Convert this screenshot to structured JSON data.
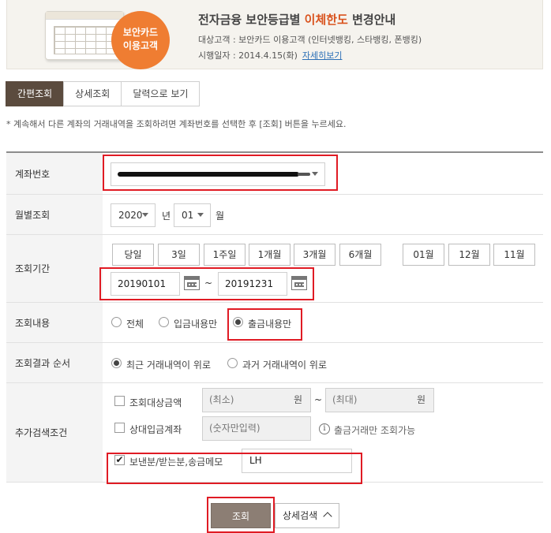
{
  "banner": {
    "card_badge_line1": "보안카드",
    "card_badge_line2": "이용고객",
    "title_prefix": "전자금융 보안등급별 ",
    "title_highlight": "이체한도",
    "title_suffix": " 변경안내",
    "target_line": "대상고객 : 보안카드 이용고객 (인터넷뱅킹, 스타뱅킹, 폰뱅킹)",
    "date_line": "시행일자 : 2014.4.15(화)",
    "detail_link": "자세히보기"
  },
  "tabs": [
    {
      "label": "간편조회",
      "active": true
    },
    {
      "label": "상세조회",
      "active": false
    },
    {
      "label": "달력으로 보기",
      "active": false
    }
  ],
  "note": "* 계속해서 다른 계좌의 거래내역을 조회하려면 계좌번호를 선택한 후 [조회] 버튼을 누르세요.",
  "form": {
    "account": {
      "label": "계좌번호"
    },
    "month": {
      "label": "월별조회",
      "year": "2020",
      "year_unit": "년",
      "month": "01",
      "month_unit": "월"
    },
    "period": {
      "label": "조회기간",
      "quick_buttons": [
        "당일",
        "3일",
        "1주일",
        "1개월",
        "3개월",
        "6개월"
      ],
      "month_buttons": [
        "01월",
        "12월",
        "11월"
      ],
      "start_date": "20190101",
      "separator": "~",
      "end_date": "20191231"
    },
    "content": {
      "label": "조회내용",
      "options": [
        "전체",
        "입금내용만",
        "출금내용만"
      ],
      "selected": "출금내용만"
    },
    "order": {
      "label": "조회결과 순서",
      "options": [
        "최근 거래내역이 위로",
        "과거 거래내역이 위로"
      ],
      "selected": "최근 거래내역이 위로"
    },
    "extra": {
      "label": "추가검색조건",
      "amount_label": "조회대상금액",
      "amount_min_placeholder": "(최소)",
      "amount_max_placeholder": "(최대)",
      "amount_unit": "원",
      "amount_sep": "~",
      "counter_label": "상대입금계좌",
      "counter_placeholder": "(숫자만입력)",
      "counter_info": "출금거래만 조회가능",
      "memo_label": "보낸분/받는분,송금메모",
      "memo_checked": true,
      "memo_value": "LH"
    }
  },
  "buttons": {
    "search": "조회",
    "detail_search": "상세검색"
  },
  "colors": {
    "accent_orange": "#ef7d32",
    "tab_active": "#5b4b3e",
    "highlight_red": "#e01b24",
    "search_button": "#8c7e74"
  }
}
